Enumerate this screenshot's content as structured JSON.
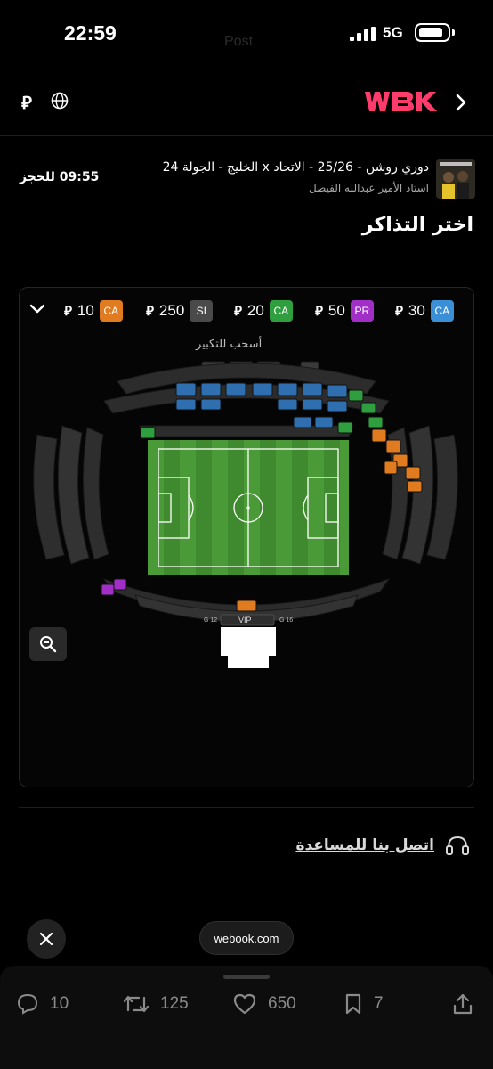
{
  "status_bar": {
    "time": "22:59",
    "network": "5G",
    "ghost_title": "Post"
  },
  "topbar": {
    "currency_symbol": "⃁",
    "logo_text": "WBK"
  },
  "event": {
    "title": "دوري روشن - 25/26 - الاتحاد x الخليج - الجولة 24",
    "venue": "استاد الأمير عبدالله الفيصل",
    "timer": "09:55 للحجز"
  },
  "section_title": "اختر التذاكر",
  "currency": "⃁",
  "prices": [
    {
      "code": "CA",
      "value": "30",
      "color": "#3b8fd6"
    },
    {
      "code": "PR",
      "value": "50",
      "color": "#a12fc7"
    },
    {
      "code": "CA",
      "value": "20",
      "color": "#2f9e3f"
    },
    {
      "code": "SI",
      "value": "250",
      "color": "#4a4a4a"
    },
    {
      "code": "CA",
      "value": "10",
      "color": "#e07b1f"
    }
  ],
  "map": {
    "drag_hint": "أسحب للتكبير",
    "vip_label": "VIP",
    "gate_left": "G 12",
    "gate_right": "G 16"
  },
  "help": {
    "label": "اتصل بنا للمساعدة"
  },
  "browser": {
    "url": "webook.com"
  },
  "actions": {
    "replies": "10",
    "reposts": "125",
    "likes": "650",
    "bookmarks": "7"
  },
  "colors": {
    "accent": "#ff3b6b",
    "pitch": "#3f8a2e"
  }
}
